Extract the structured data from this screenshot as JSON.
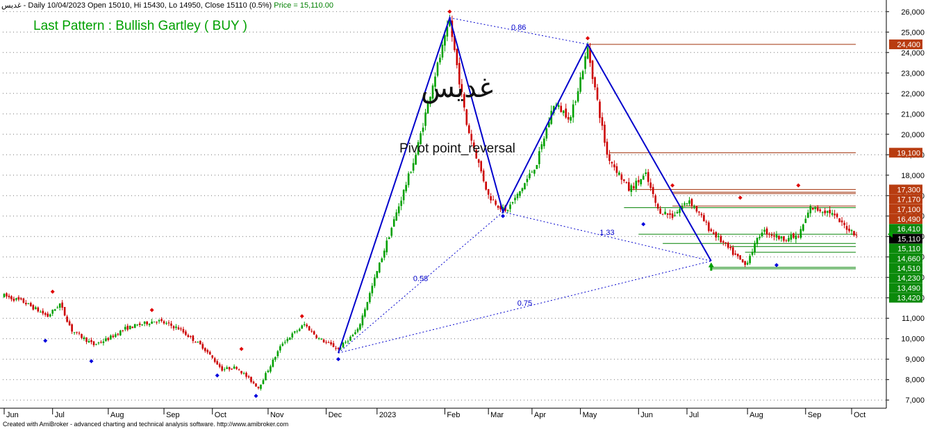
{
  "header": {
    "symbol": "غدیس",
    "info": " - Daily 10/04/2023 Open 15010, Hi 15430, Lo 14950, Close 15110 (0.5%)",
    "price_label": "Price = 15,110.00"
  },
  "annotations": {
    "pattern": "Last Pattern : Bullish Gartley ( BUY )",
    "symbol_large": "غدیس",
    "pivot": "Pivot point_reversal"
  },
  "footer": "Created with AmiBroker - advanced charting and technical analysis software. http://www.amibroker.com",
  "colors": {
    "up": "#00a000",
    "down": "#cc0000",
    "pattern_line": "#0000cc",
    "resistance": "#a0300a",
    "support": "#008000",
    "current": "#000000"
  },
  "chart_data": {
    "type": "candlestick",
    "ylim": [
      6600,
      26400
    ],
    "y_ticks": [
      "7,000",
      "8,000",
      "9,000",
      "10,000",
      "11,000",
      "12,000",
      "13,000",
      "14,000",
      "15,000",
      "16,000",
      "17,000",
      "18,000",
      "19,000",
      "20,000",
      "21,000",
      "22,000",
      "23,000",
      "24,000",
      "25,000",
      "26,000"
    ],
    "x_ticks": [
      {
        "label": "Jun",
        "i": 0
      },
      {
        "label": "Jul",
        "i": 20
      },
      {
        "label": "Aug",
        "i": 43
      },
      {
        "label": "Sep",
        "i": 66
      },
      {
        "label": "Oct",
        "i": 86
      },
      {
        "label": "Nov",
        "i": 109
      },
      {
        "label": "Dec",
        "i": 133
      },
      {
        "label": "2023",
        "i": 154
      },
      {
        "label": "Feb",
        "i": 182
      },
      {
        "label": "Mar",
        "i": 200
      },
      {
        "label": "Apr",
        "i": 218
      },
      {
        "label": "May",
        "i": 238
      },
      {
        "label": "Jun",
        "i": 262
      },
      {
        "label": "Jul",
        "i": 282
      },
      {
        "label": "Aug",
        "i": 307
      },
      {
        "label": "Sep",
        "i": 331
      },
      {
        "label": "Oct",
        "i": 350
      }
    ],
    "n_bars": 353,
    "anchors": [
      [
        0,
        12100
      ],
      [
        8,
        11800
      ],
      [
        18,
        11100
      ],
      [
        23,
        11700
      ],
      [
        28,
        10400
      ],
      [
        37,
        9700
      ],
      [
        43,
        10000
      ],
      [
        50,
        10500
      ],
      [
        63,
        10900
      ],
      [
        72,
        10500
      ],
      [
        82,
        9600
      ],
      [
        90,
        8500
      ],
      [
        96,
        8600
      ],
      [
        105,
        7600
      ],
      [
        115,
        9800
      ],
      [
        124,
        10700
      ],
      [
        130,
        10000
      ],
      [
        138,
        9500
      ],
      [
        146,
        10400
      ],
      [
        156,
        14000
      ],
      [
        170,
        19000
      ],
      [
        177,
        22500
      ],
      [
        184,
        25500
      ],
      [
        191,
        20500
      ],
      [
        200,
        17000
      ],
      [
        207,
        16200
      ],
      [
        212,
        17000
      ],
      [
        220,
        18600
      ],
      [
        227,
        21500
      ],
      [
        234,
        20800
      ],
      [
        241,
        24200
      ],
      [
        245,
        21600
      ],
      [
        249,
        19000
      ],
      [
        258,
        17300
      ],
      [
        265,
        18000
      ],
      [
        270,
        16300
      ],
      [
        276,
        16000
      ],
      [
        283,
        16800
      ],
      [
        291,
        15400
      ],
      [
        300,
        14300
      ],
      [
        306,
        13600
      ],
      [
        313,
        15300
      ],
      [
        321,
        14900
      ],
      [
        328,
        15000
      ],
      [
        333,
        16400
      ],
      [
        341,
        16200
      ],
      [
        346,
        15600
      ],
      [
        352,
        15110
      ]
    ],
    "pattern_points": [
      {
        "label": "X",
        "i": 138,
        "y": 9300
      },
      {
        "label": "A",
        "i": 184,
        "y": 25700
      },
      {
        "label": "B",
        "i": 206,
        "y": 16200
      },
      {
        "label": "C",
        "i": 241,
        "y": 24400
      },
      {
        "label": "D",
        "i": 292,
        "y": 13800
      }
    ],
    "ratio_lines": [
      {
        "from": "A",
        "to": "C",
        "label": "0.86"
      },
      {
        "from": "X",
        "to": "B",
        "label": "0.58"
      },
      {
        "from": "B",
        "to": "D",
        "label": "1.33"
      },
      {
        "from": "X",
        "to": "D",
        "label": "0.75"
      }
    ],
    "levels": [
      {
        "value": 24400,
        "label": "24,400",
        "kind": "resistance",
        "from": 241
      },
      {
        "value": 19100,
        "label": "19,100",
        "kind": "resistance",
        "from": 250
      },
      {
        "value": 17300,
        "label": "17,300",
        "kind": "resistance",
        "from": 258
      },
      {
        "value": 17170,
        "label": "17,170",
        "kind": "resistance",
        "from": 276
      },
      {
        "value": 17100,
        "label": "17,100",
        "kind": "resistance",
        "from": 276
      },
      {
        "value": 16490,
        "label": "16,490",
        "kind": "resistance",
        "from": 276
      },
      {
        "value": 16410,
        "label": "16,410",
        "kind": "support",
        "from": 256
      },
      {
        "value": 15110,
        "label": "15,110",
        "kind": "current",
        "from": 352
      },
      {
        "value": 15110,
        "label": "15,110",
        "kind": "support",
        "from": 262
      },
      {
        "value": 14660,
        "label": "14,660",
        "kind": "support",
        "from": 272
      },
      {
        "value": 14510,
        "label": "14,510",
        "kind": "support",
        "from": 300
      },
      {
        "value": 14230,
        "label": "14,230",
        "kind": "support",
        "from": 306
      },
      {
        "value": 13490,
        "label": "13,490",
        "kind": "support",
        "from": 292
      },
      {
        "value": 13420,
        "label": "13,420",
        "kind": "support",
        "from": 292
      }
    ],
    "swing_highs": [
      [
        20,
        12300
      ],
      [
        61,
        11400
      ],
      [
        98,
        9500
      ],
      [
        123,
        11100
      ],
      [
        184,
        26000
      ],
      [
        241,
        24700
      ],
      [
        276,
        17500
      ],
      [
        304,
        16900
      ],
      [
        328,
        17500
      ]
    ],
    "swing_lows": [
      [
        17,
        9900
      ],
      [
        36,
        8900
      ],
      [
        88,
        8200
      ],
      [
        104,
        7200
      ],
      [
        138,
        9000
      ],
      [
        206,
        16000
      ],
      [
        264,
        15600
      ],
      [
        319,
        13600
      ]
    ]
  }
}
